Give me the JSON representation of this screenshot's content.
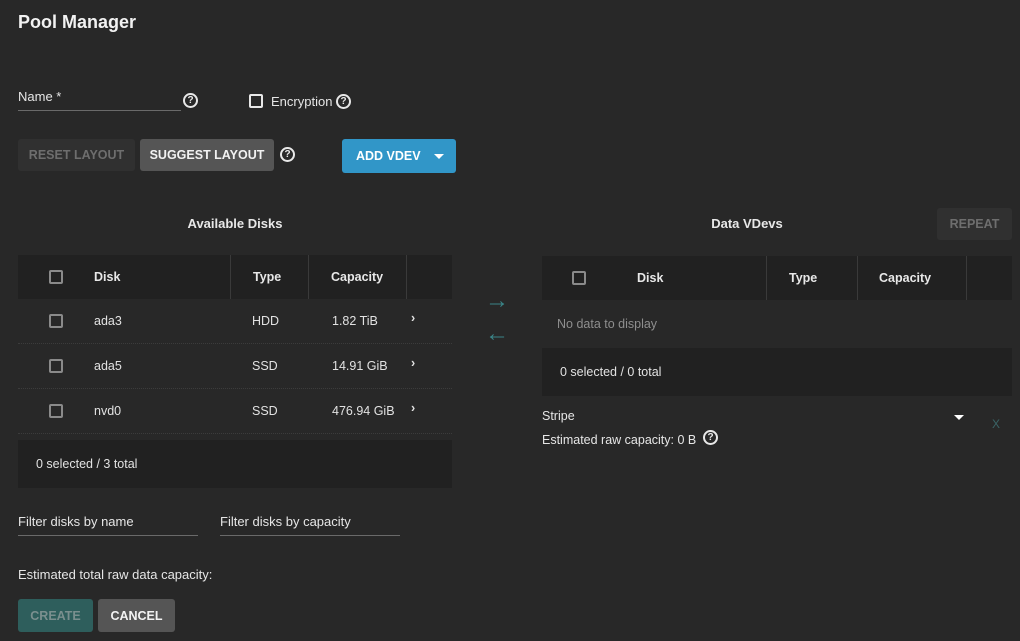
{
  "page": {
    "title": "Pool Manager"
  },
  "form": {
    "name_label": "Name *",
    "name_value": "",
    "encryption_label": "Encryption",
    "encryption_checked": false
  },
  "toolbar": {
    "reset_layout": "RESET LAYOUT",
    "suggest_layout": "SUGGEST LAYOUT",
    "add_vdev": "ADD VDEV"
  },
  "available_disks": {
    "title": "Available Disks",
    "columns": [
      "Disk",
      "Type",
      "Capacity"
    ],
    "rows": [
      {
        "disk": "ada3",
        "type": "HDD",
        "capacity": "1.82 TiB"
      },
      {
        "disk": "ada5",
        "type": "SSD",
        "capacity": "14.91 GiB"
      },
      {
        "disk": "nvd0",
        "type": "SSD",
        "capacity": "476.94 GiB"
      }
    ],
    "footer": "0 selected / 3 total",
    "filter_name_placeholder": "Filter disks by name",
    "filter_capacity_placeholder": "Filter disks by capacity"
  },
  "data_vdevs": {
    "title": "Data VDevs",
    "repeat_label": "REPEAT",
    "columns": [
      "Disk",
      "Type",
      "Capacity"
    ],
    "empty_message": "No data to display",
    "footer": "0 selected / 0 total",
    "layout_value": "Stripe",
    "estimated_raw_capacity": "Estimated raw capacity: 0 B",
    "remove_label": "X"
  },
  "summary": {
    "estimated_total": "Estimated total raw data capacity:",
    "create_label": "CREATE",
    "cancel_label": "CANCEL"
  },
  "colors": {
    "background": "#282828",
    "primary": "#3196c8",
    "accent_teal": "#3a8588",
    "table_header": "#212121"
  }
}
